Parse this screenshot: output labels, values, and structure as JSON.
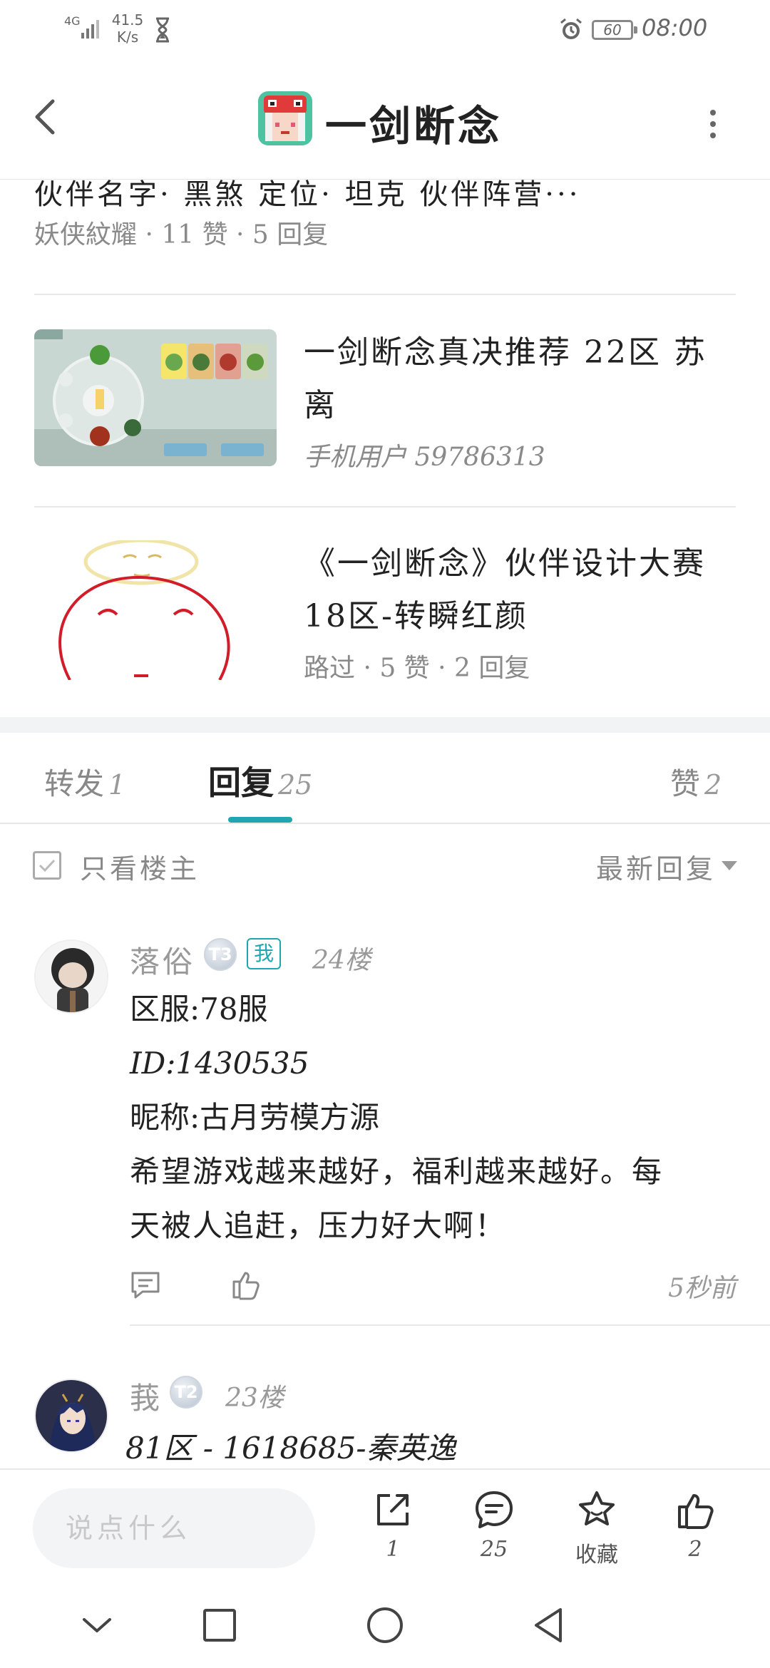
{
  "status_bar": {
    "network": "4G",
    "speed_value": "41.5",
    "speed_unit": "K/s",
    "battery": "60",
    "time": "08:00"
  },
  "header": {
    "title": "一剑断念"
  },
  "posts": [
    {
      "title": "伙伴名字· 黑煞   定位· 坦克   伙伴阵营···",
      "meta": "妖侠紋耀 · 11 赞 · 5 回复"
    },
    {
      "title": "一剑断念真决推荐 22区 苏离",
      "meta": "手机用户 59786313"
    },
    {
      "title": "《一剑断念》伙伴设计大赛18区-转瞬红颜",
      "meta": "路过 · 5 赞 · 2 回复"
    }
  ],
  "tabs": [
    {
      "label": "转发",
      "count": "1"
    },
    {
      "label": "回复",
      "count": "25"
    },
    {
      "label": "赞",
      "count": "2"
    }
  ],
  "filter": {
    "only_host_label": "只看楼主",
    "sort_label": "最新回复"
  },
  "comments": [
    {
      "name": "落俗",
      "level": "T3",
      "me_badge": "我",
      "floor": "24楼",
      "lines": [
        "区服:78服",
        "ID:1430535",
        "昵称:古月劳模方源",
        "希望游戏越来越好，福利越来越好。每",
        "天被人追赶，压力好大啊！"
      ],
      "time": "5秒前"
    },
    {
      "name": "莪",
      "level": "T2",
      "floor": "23楼",
      "lines": [
        "81区 - 1618685-秦英逸"
      ]
    }
  ],
  "bottom_bar": {
    "input_placeholder": "说点什么",
    "share_count": "1",
    "comment_count": "25",
    "favorite_label": "收藏",
    "like_count": "2"
  },
  "colors": {
    "accent": "#1fa6b0",
    "muted_text": "#999999",
    "divider": "#e8e8e8"
  }
}
